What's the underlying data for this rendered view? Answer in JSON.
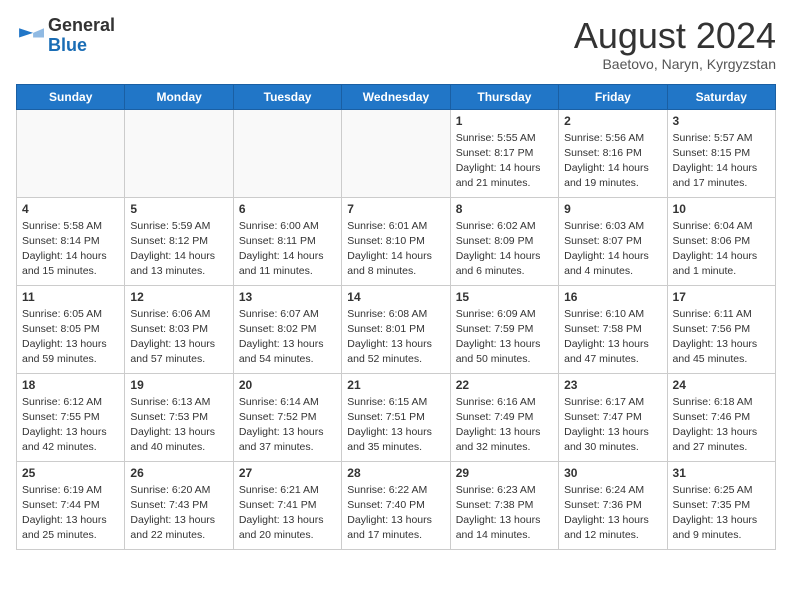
{
  "header": {
    "logo_general": "General",
    "logo_blue": "Blue",
    "month_title": "August 2024",
    "location": "Baetovo, Naryn, Kyrgyzstan"
  },
  "weekdays": [
    "Sunday",
    "Monday",
    "Tuesday",
    "Wednesday",
    "Thursday",
    "Friday",
    "Saturday"
  ],
  "weeks": [
    [
      {
        "day": "",
        "info": ""
      },
      {
        "day": "",
        "info": ""
      },
      {
        "day": "",
        "info": ""
      },
      {
        "day": "",
        "info": ""
      },
      {
        "day": "1",
        "info": "Sunrise: 5:55 AM\nSunset: 8:17 PM\nDaylight: 14 hours\nand 21 minutes."
      },
      {
        "day": "2",
        "info": "Sunrise: 5:56 AM\nSunset: 8:16 PM\nDaylight: 14 hours\nand 19 minutes."
      },
      {
        "day": "3",
        "info": "Sunrise: 5:57 AM\nSunset: 8:15 PM\nDaylight: 14 hours\nand 17 minutes."
      }
    ],
    [
      {
        "day": "4",
        "info": "Sunrise: 5:58 AM\nSunset: 8:14 PM\nDaylight: 14 hours\nand 15 minutes."
      },
      {
        "day": "5",
        "info": "Sunrise: 5:59 AM\nSunset: 8:12 PM\nDaylight: 14 hours\nand 13 minutes."
      },
      {
        "day": "6",
        "info": "Sunrise: 6:00 AM\nSunset: 8:11 PM\nDaylight: 14 hours\nand 11 minutes."
      },
      {
        "day": "7",
        "info": "Sunrise: 6:01 AM\nSunset: 8:10 PM\nDaylight: 14 hours\nand 8 minutes."
      },
      {
        "day": "8",
        "info": "Sunrise: 6:02 AM\nSunset: 8:09 PM\nDaylight: 14 hours\nand 6 minutes."
      },
      {
        "day": "9",
        "info": "Sunrise: 6:03 AM\nSunset: 8:07 PM\nDaylight: 14 hours\nand 4 minutes."
      },
      {
        "day": "10",
        "info": "Sunrise: 6:04 AM\nSunset: 8:06 PM\nDaylight: 14 hours\nand 1 minute."
      }
    ],
    [
      {
        "day": "11",
        "info": "Sunrise: 6:05 AM\nSunset: 8:05 PM\nDaylight: 13 hours\nand 59 minutes."
      },
      {
        "day": "12",
        "info": "Sunrise: 6:06 AM\nSunset: 8:03 PM\nDaylight: 13 hours\nand 57 minutes."
      },
      {
        "day": "13",
        "info": "Sunrise: 6:07 AM\nSunset: 8:02 PM\nDaylight: 13 hours\nand 54 minutes."
      },
      {
        "day": "14",
        "info": "Sunrise: 6:08 AM\nSunset: 8:01 PM\nDaylight: 13 hours\nand 52 minutes."
      },
      {
        "day": "15",
        "info": "Sunrise: 6:09 AM\nSunset: 7:59 PM\nDaylight: 13 hours\nand 50 minutes."
      },
      {
        "day": "16",
        "info": "Sunrise: 6:10 AM\nSunset: 7:58 PM\nDaylight: 13 hours\nand 47 minutes."
      },
      {
        "day": "17",
        "info": "Sunrise: 6:11 AM\nSunset: 7:56 PM\nDaylight: 13 hours\nand 45 minutes."
      }
    ],
    [
      {
        "day": "18",
        "info": "Sunrise: 6:12 AM\nSunset: 7:55 PM\nDaylight: 13 hours\nand 42 minutes."
      },
      {
        "day": "19",
        "info": "Sunrise: 6:13 AM\nSunset: 7:53 PM\nDaylight: 13 hours\nand 40 minutes."
      },
      {
        "day": "20",
        "info": "Sunrise: 6:14 AM\nSunset: 7:52 PM\nDaylight: 13 hours\nand 37 minutes."
      },
      {
        "day": "21",
        "info": "Sunrise: 6:15 AM\nSunset: 7:51 PM\nDaylight: 13 hours\nand 35 minutes."
      },
      {
        "day": "22",
        "info": "Sunrise: 6:16 AM\nSunset: 7:49 PM\nDaylight: 13 hours\nand 32 minutes."
      },
      {
        "day": "23",
        "info": "Sunrise: 6:17 AM\nSunset: 7:47 PM\nDaylight: 13 hours\nand 30 minutes."
      },
      {
        "day": "24",
        "info": "Sunrise: 6:18 AM\nSunset: 7:46 PM\nDaylight: 13 hours\nand 27 minutes."
      }
    ],
    [
      {
        "day": "25",
        "info": "Sunrise: 6:19 AM\nSunset: 7:44 PM\nDaylight: 13 hours\nand 25 minutes."
      },
      {
        "day": "26",
        "info": "Sunrise: 6:20 AM\nSunset: 7:43 PM\nDaylight: 13 hours\nand 22 minutes."
      },
      {
        "day": "27",
        "info": "Sunrise: 6:21 AM\nSunset: 7:41 PM\nDaylight: 13 hours\nand 20 minutes."
      },
      {
        "day": "28",
        "info": "Sunrise: 6:22 AM\nSunset: 7:40 PM\nDaylight: 13 hours\nand 17 minutes."
      },
      {
        "day": "29",
        "info": "Sunrise: 6:23 AM\nSunset: 7:38 PM\nDaylight: 13 hours\nand 14 minutes."
      },
      {
        "day": "30",
        "info": "Sunrise: 6:24 AM\nSunset: 7:36 PM\nDaylight: 13 hours\nand 12 minutes."
      },
      {
        "day": "31",
        "info": "Sunrise: 6:25 AM\nSunset: 7:35 PM\nDaylight: 13 hours\nand 9 minutes."
      }
    ]
  ]
}
